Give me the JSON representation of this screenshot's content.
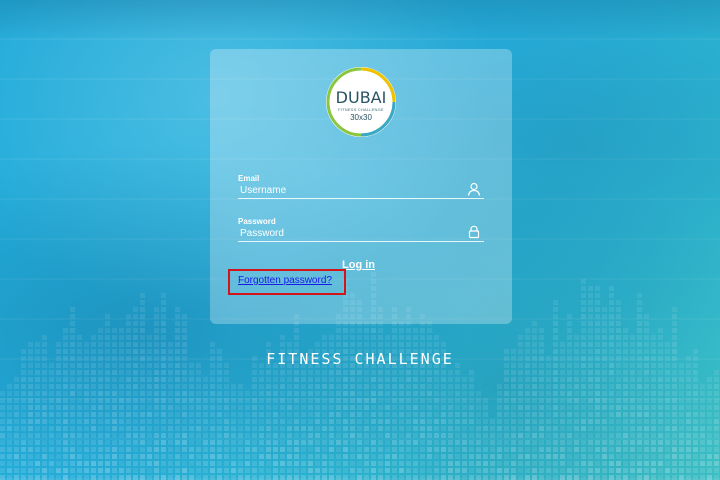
{
  "app": {
    "logo": {
      "title": "DUBAI",
      "subtitle": "FITNESS CHALLENGE",
      "number": "30x30",
      "icon": "dubai-30x30-logo-icon"
    },
    "brand_colors": {
      "background": "#27b3df",
      "accent_green": "#8cc63f",
      "highlight_red": "#d3141b",
      "link_blue": "#1a1ae8"
    }
  },
  "login_form": {
    "email": {
      "label": "Email",
      "placeholder": "Username",
      "value": "",
      "icon": "user-icon"
    },
    "password": {
      "label": "Password",
      "placeholder": "Password",
      "value": "",
      "icon": "lock-icon"
    },
    "login_label": "Log in",
    "forgot_label": "Forgotten password?"
  },
  "footer": {
    "title": "FITNESS CHALLENGE"
  }
}
